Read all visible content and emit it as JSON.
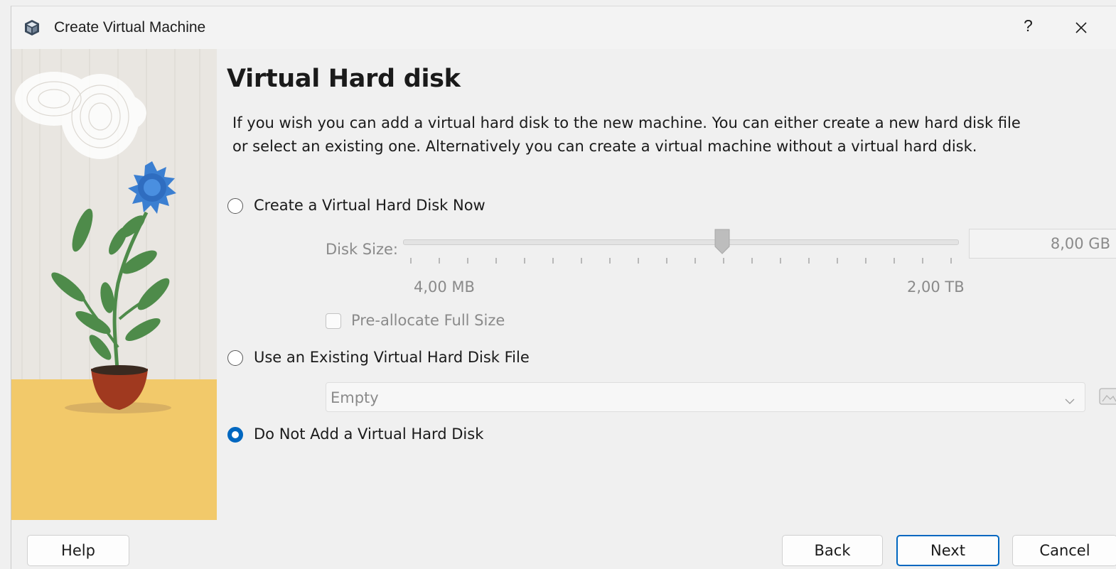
{
  "window": {
    "title": "Create Virtual Machine",
    "help_glyph": "?",
    "close_glyph": "✕"
  },
  "page": {
    "heading": "Virtual Hard disk",
    "description": "If you wish you can add a virtual hard disk to the new machine. You can either create a new hard disk file or select an existing one. Alternatively you can create a virtual machine without a virtual hard disk."
  },
  "options": {
    "create_now": {
      "label": "Create a Virtual Hard Disk Now",
      "selected": false
    },
    "use_existing": {
      "label": "Use an Existing Virtual Hard Disk File",
      "selected": false
    },
    "do_not_add": {
      "label": "Do Not Add a Virtual Hard Disk",
      "selected": true
    }
  },
  "disk_size": {
    "label": "Disk Size:",
    "value": "8,00 GB",
    "min_label": "4,00 MB",
    "max_label": "2,00 TB",
    "slider_fraction": 0.577,
    "enabled": false
  },
  "preallocate": {
    "label": "Pre-allocate Full Size",
    "checked": false
  },
  "existing_file": {
    "value": "Empty",
    "enabled": false
  },
  "footer": {
    "help": "Help",
    "back": "Back",
    "next": "Next",
    "cancel": "Cancel"
  },
  "colors": {
    "accent": "#0067c0",
    "sand": "#f2c96a",
    "flower": "#3b7fd1",
    "leaf": "#4e8b4a",
    "pot": "#a0391f"
  },
  "icons": [
    "virtualbox-cube-icon",
    "help-icon",
    "close-icon",
    "chevron-down-icon",
    "folder-icon"
  ]
}
